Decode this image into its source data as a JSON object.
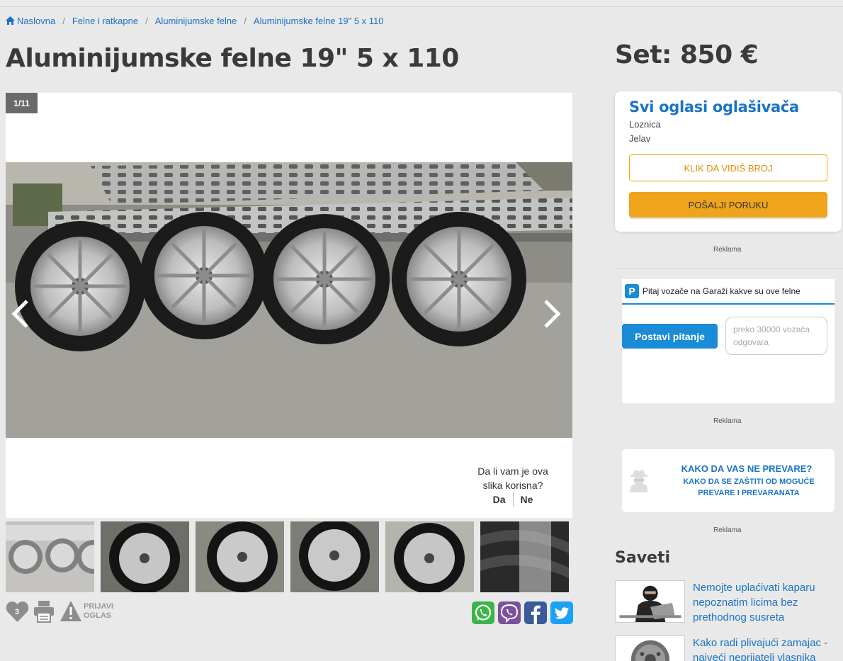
{
  "breadcrumb": {
    "items": [
      "Naslovna",
      "Felne i ratkapne",
      "Aluminijumske felne",
      "Aluminijumske felne 19\" 5 x 110"
    ],
    "separator": "/"
  },
  "listing": {
    "title": "Aluminijumske felne 19\" 5 x 110",
    "price": "Set: 850 €"
  },
  "gallery": {
    "counter": "1/11",
    "feedback_question": "Da li vam je ova slika korisna?",
    "feedback_yes": "Da",
    "feedback_no": "Ne",
    "thumb_count": 6
  },
  "actions": {
    "favorite_count": "3",
    "report_label_1": "PRIJAVI",
    "report_label_2": "OGLAS"
  },
  "seller": {
    "all_ads": "Svi oglasi oglašivača",
    "city": "Loznica",
    "place": "Jelav",
    "phone_button": "KLIK DA VIDIŠ BROJ",
    "message_button": "POŠALJI PORUKU"
  },
  "ads": {
    "label": "Reklama"
  },
  "garaza": {
    "header": "Pitaj vozače na Garaži kakve su ove felne",
    "logo": "P",
    "ask_button": "Postavi pitanje",
    "bubble": "preko 30000 vozača odgovara"
  },
  "scam": {
    "title": "KAKO DA VAS NE PREVARE?",
    "subtitle": "KAKO DA SE ZAŠTITI OD MOGUĆE PREVARE I PREVARANATA"
  },
  "tips": {
    "heading": "Saveti",
    "items": [
      "Nemojte uplaćivati kaparu nepoznatim licima bez prethodnog susreta",
      "Kako radi plivajući zamajac - najveći neprijatelj vlasnika"
    ]
  },
  "colors": {
    "link": "#1a73c7",
    "orange": "#f0a41c",
    "garaza_blue": "#1a8bd6"
  }
}
